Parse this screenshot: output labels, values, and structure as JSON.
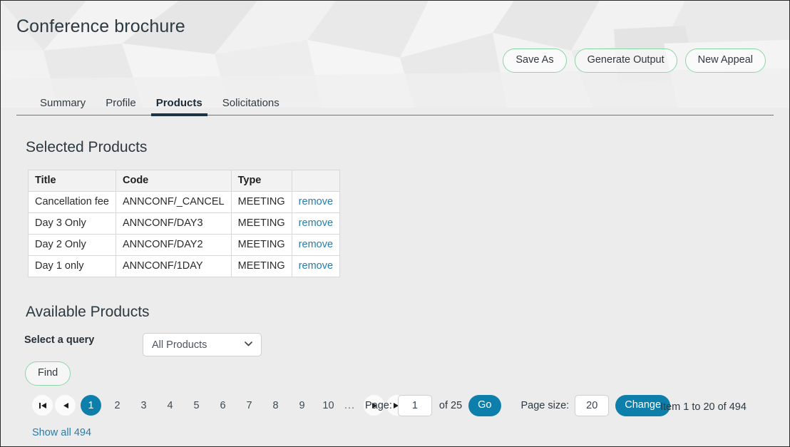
{
  "header": {
    "title": "Conference brochure",
    "actions": [
      {
        "label": "Save As",
        "name": "save-as-button"
      },
      {
        "label": "Generate Output",
        "name": "generate-output-button"
      },
      {
        "label": "New Appeal",
        "name": "new-appeal-button"
      }
    ]
  },
  "tabs": [
    {
      "label": "Summary",
      "active": false
    },
    {
      "label": "Profile",
      "active": false
    },
    {
      "label": "Products",
      "active": true
    },
    {
      "label": "Solicitations",
      "active": false
    }
  ],
  "selected_products": {
    "title": "Selected Products",
    "columns": [
      "Title",
      "Code",
      "Type",
      ""
    ],
    "rows": [
      {
        "title": "Cancellation fee",
        "code": "ANNCONF/_CANCEL",
        "type": "MEETING",
        "action": "remove"
      },
      {
        "title": "Day 3 Only",
        "code": "ANNCONF/DAY3",
        "type": "MEETING",
        "action": "remove"
      },
      {
        "title": "Day 2 Only",
        "code": "ANNCONF/DAY2",
        "type": "MEETING",
        "action": "remove"
      },
      {
        "title": "Day 1 only",
        "code": "ANNCONF/1DAY",
        "type": "MEETING",
        "action": "remove"
      }
    ]
  },
  "available_products": {
    "title": "Available Products",
    "query_label": "Select a query",
    "query_value": "All Products",
    "query_options": [
      "All Products"
    ],
    "find_label": "Find",
    "show_all_label": "Show all 494"
  },
  "pagination": {
    "first_icon": "first-page-icon",
    "prev_icon": "previous-page-icon",
    "next_icon": "next-page-icon",
    "last_icon": "last-page-icon",
    "pages": [
      "1",
      "2",
      "3",
      "4",
      "5",
      "6",
      "7",
      "8",
      "9",
      "10"
    ],
    "active_page": "1",
    "ellipsis": "...",
    "page_label": "Page:",
    "page_value": "1",
    "page_total_text": "of 25",
    "go_label": "Go",
    "page_size_label": "Page size:",
    "page_size_value": "20",
    "change_label": "Change",
    "item_count_text": "Item 1 to 20 of 494"
  },
  "colors": {
    "accent_teal": "#0e7faa",
    "pill_border_green": "#8bd6a6",
    "link_blue": "#2a7ca8",
    "tab_underline": "#1d3444",
    "page_background": "#ececec"
  }
}
